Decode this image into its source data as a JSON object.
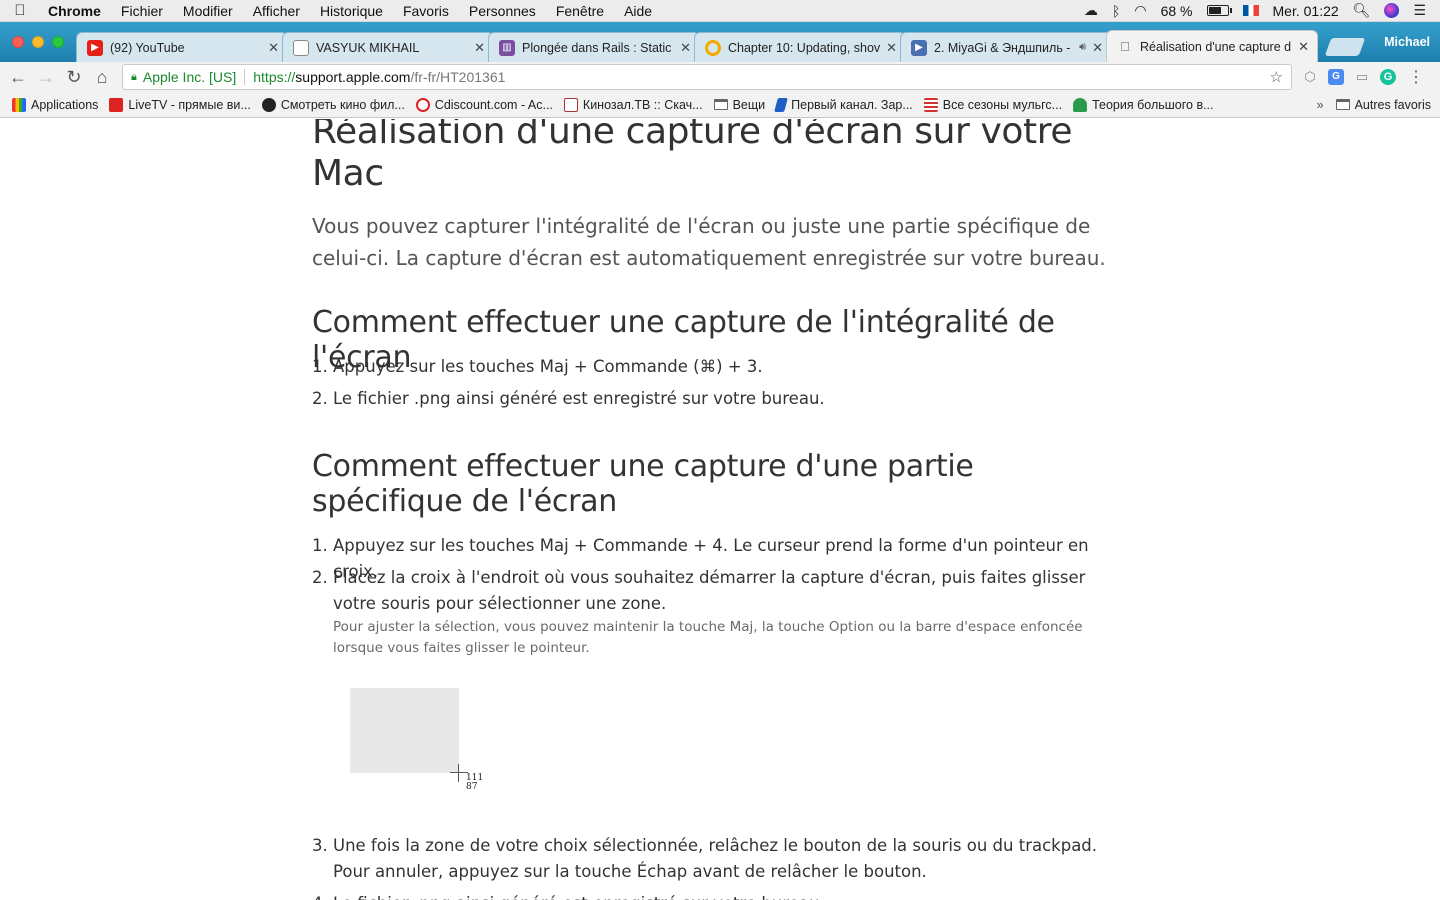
{
  "menubar": {
    "apple": "",
    "app_name": "Chrome",
    "items": [
      "Fichier",
      "Modifier",
      "Afficher",
      "Historique",
      "Favoris",
      "Personnes",
      "Fenêtre",
      "Aide"
    ],
    "battery_percent": "68 %",
    "battery_level": 0.68,
    "clock": "Mer. 01:22"
  },
  "tabs": [
    {
      "title": "(92) YouTube",
      "favicon": "youtube-icon",
      "color": "#e62117"
    },
    {
      "title": "VASYUK MIKHAIL",
      "favicon": "document-icon",
      "color": "#888888"
    },
    {
      "title": "Plongée dans Rails : Static",
      "favicon": "trello-icon",
      "color": "#7b4fa0"
    },
    {
      "title": "Chapter 10: Updating, shov",
      "favicon": "ring-icon",
      "color": "#f2a900"
    },
    {
      "title": "2. MiyaGi & Эндшпиль -",
      "favicon": "play-icon",
      "color": "#4a6fb0"
    },
    {
      "title": "Réalisation d'une capture d",
      "favicon": "apple-icon",
      "color": "#555555"
    }
  ],
  "profile_name": "Michael",
  "omnibox": {
    "secure_label": "Apple Inc. [US]",
    "scheme": "https://",
    "host": "support.apple.com",
    "path": "/fr-fr/HT201361"
  },
  "bookmarks": [
    {
      "label": "Applications",
      "icon": "grid-icon"
    },
    {
      "label": "LiveTV - прямые ви...",
      "icon": "livetv-icon"
    },
    {
      "label": "Смотреть кино фил...",
      "icon": "kino-icon"
    },
    {
      "label": "Cdiscount.com - Ac...",
      "icon": "cdiscount-icon"
    },
    {
      "label": "Кинозал.ТВ :: Скач...",
      "icon": "kinozal-icon"
    },
    {
      "label": "Вещи",
      "icon": "folder-icon"
    },
    {
      "label": "Первый канал. Зар...",
      "icon": "perviy-icon"
    },
    {
      "label": "Все сезоны мульгс...",
      "icon": "flag-icon"
    },
    {
      "label": "Теория большого в...",
      "icon": "tree-icon"
    }
  ],
  "bookmarks_more": "»",
  "bookmarks_other": "Autres favoris",
  "article": {
    "title": "Réalisation d'une capture d'écran sur votre Mac",
    "intro": "Vous pouvez capturer l'intégralité de l'écran ou juste une partie spécifique de celui-ci. La capture d'écran est automatiquement enregistrée sur votre bureau.",
    "section1": {
      "heading": "Comment effectuer une capture de l'intégralité de l'écran",
      "steps": [
        {
          "num": "1.",
          "text": "Appuyez sur les touches Maj + Commande (⌘) + 3."
        },
        {
          "num": "2.",
          "text": "Le fichier .png ainsi généré est enregistré sur votre bureau."
        }
      ]
    },
    "section2": {
      "heading": "Comment effectuer une capture d'une partie spécifique de l'écran",
      "steps": [
        {
          "num": "1.",
          "text": "Appuyez sur les touches Maj + Commande + 4. Le curseur prend la forme d'un pointeur en croix."
        },
        {
          "num": "2.",
          "text": "Placez la croix à l'endroit où vous souhaitez démarrer la capture d'écran, puis faites glisser votre souris pour sélectionner une zone."
        },
        {
          "num": "3.",
          "text": "Une fois la zone de votre choix sélectionnée, relâchez le bouton de la souris ou du trackpad. Pour annuler, appuyez sur la touche Échap avant de relâcher le bouton."
        },
        {
          "num": "4.",
          "text": "Le fichier .png ainsi généré est enregistré sur votre bureau."
        }
      ],
      "note": "Pour ajuster la sélection, vous pouvez maintenir la touche Maj, la touche Option ou la barre d'espace enfoncée lorsque vous faites glisser le pointeur.",
      "demo_width": "111",
      "demo_height": "87"
    }
  }
}
